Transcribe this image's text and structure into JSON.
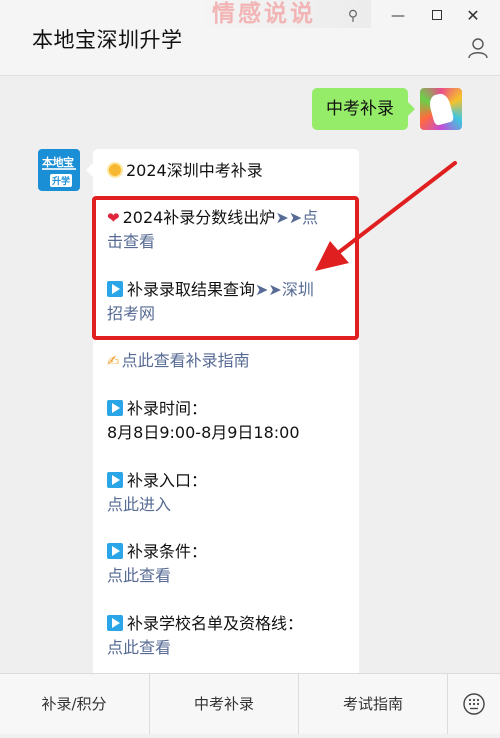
{
  "window": {
    "title": "本地宝深圳升学",
    "watermark": "情感说说",
    "pin_glyph": "⚲",
    "minimize_glyph": "—",
    "close_glyph": "✕"
  },
  "chat": {
    "user_message": "中考补录",
    "bot_avatar": {
      "top_text": "本地宝",
      "bottom_text": "升学"
    },
    "bot_message": {
      "headline": "2024深圳中考补录",
      "items": [
        {
          "text": "2024补录分数线出炉",
          "arrows": "➤➤",
          "link": "点击查看"
        },
        {
          "text": "补录录取结果查询",
          "arrows": "➤➤",
          "link": "深圳招考网"
        }
      ],
      "guide_link": "点此查看补录指南",
      "sections": [
        {
          "label": "补录时间：",
          "value": "8月8日9:00-8月9日18:00"
        },
        {
          "label": "补录入口：",
          "link": "点此进入"
        },
        {
          "label": "补录条件：",
          "link": "点此查看"
        },
        {
          "label": "补录学校名单及资格线：",
          "link": "点此查看"
        }
      ]
    }
  },
  "menu": {
    "items": [
      "补录/积分",
      "中考补录",
      "考试指南"
    ]
  },
  "colors": {
    "link": "#576b95",
    "user_bubble": "#95ec69",
    "highlight": "#e02020"
  }
}
